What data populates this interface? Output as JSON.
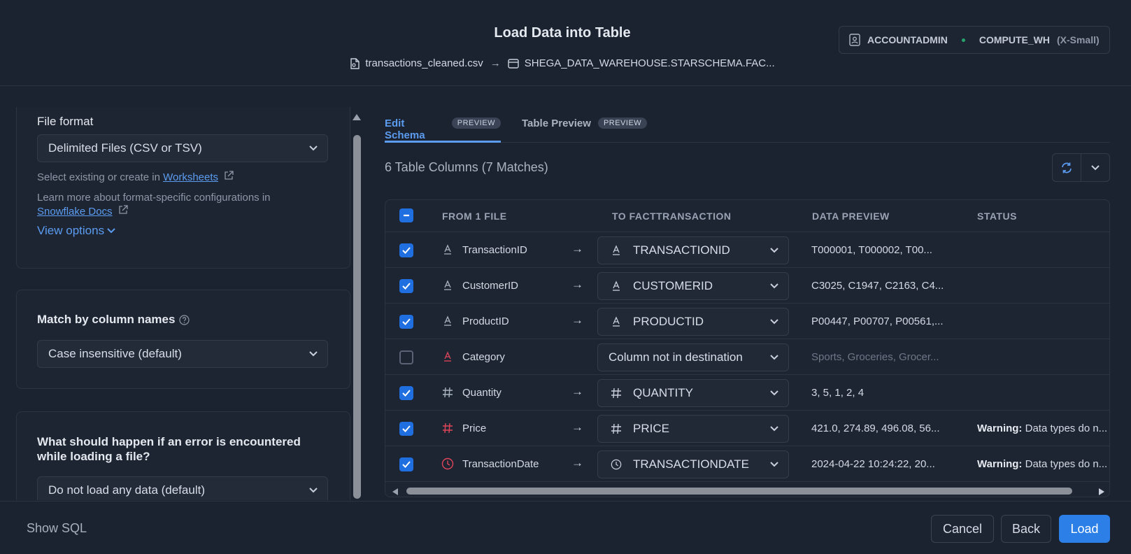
{
  "header": {
    "title": "Load Data into Table",
    "source_file": "transactions_cleaned.csv",
    "arrow": "→",
    "destination": "SHEGA_DATA_WAREHOUSE.STARSCHEMA.FAC...",
    "role": "ACCOUNTADMIN",
    "warehouse": "COMPUTE_WH",
    "warehouse_size": "(X-Small)"
  },
  "left": {
    "file_format": {
      "label": "File format",
      "value": "Delimited Files (CSV or TSV)",
      "help_prefix": "Select existing or create in",
      "help_link": "Worksheets",
      "learn_prefix": "Learn more about format-specific configurations in",
      "learn_link": "Snowflake Docs",
      "view_options": "View options"
    },
    "match": {
      "label": "Match by column names",
      "value": "Case insensitive (default)"
    },
    "on_error": {
      "label_line1": "What should happen if an error is encountered",
      "label_line2": "while loading a file?",
      "value": "Do not load any data (default)"
    }
  },
  "tabs": [
    {
      "label": "Edit Schema",
      "badge": "PREVIEW"
    },
    {
      "label": "Table Preview",
      "badge": "PREVIEW"
    }
  ],
  "summary": "6 Table Columns (7 Matches)",
  "table": {
    "headers": [
      "FROM 1 FILE",
      "TO FACTTRANSACTION",
      "DATA PREVIEW",
      "STATUS"
    ],
    "rows": [
      {
        "checked": true,
        "src_type": "text",
        "src_error": false,
        "src": "TransactionID",
        "arrow": "→",
        "dest_type": "text",
        "dest": "TRANSACTIONID",
        "preview": "T000001, T000002, T00...",
        "status_bold": "",
        "status": ""
      },
      {
        "checked": true,
        "src_type": "text",
        "src_error": false,
        "src": "CustomerID",
        "arrow": "→",
        "dest_type": "text",
        "dest": "CUSTOMERID",
        "preview": "C3025, C1947, C2163, C4...",
        "status_bold": "",
        "status": ""
      },
      {
        "checked": true,
        "src_type": "text",
        "src_error": false,
        "src": "ProductID",
        "arrow": "→",
        "dest_type": "text",
        "dest": "PRODUCTID",
        "preview": "P00447, P00707, P00561,...",
        "status_bold": "",
        "status": ""
      },
      {
        "checked": false,
        "src_type": "text",
        "src_error": true,
        "src": "Category",
        "arrow": "",
        "dest_type": "",
        "dest": "Column not in destination",
        "preview": "Sports, Groceries, Grocer...",
        "status_bold": "",
        "status": ""
      },
      {
        "checked": true,
        "src_type": "number",
        "src_error": false,
        "src": "Quantity",
        "arrow": "→",
        "dest_type": "number",
        "dest": "QUANTITY",
        "preview": "3, 5, 1, 2, 4",
        "status_bold": "",
        "status": ""
      },
      {
        "checked": true,
        "src_type": "number",
        "src_error": true,
        "src": "Price",
        "arrow": "→",
        "dest_type": "number",
        "dest": "PRICE",
        "preview": "421.0, 274.89, 496.08, 56...",
        "status_bold": "Warning:",
        "status": " Data types do n..."
      },
      {
        "checked": true,
        "src_type": "time",
        "src_error": true,
        "src": "TransactionDate",
        "arrow": "→",
        "dest_type": "time",
        "dest": "TRANSACTIONDATE",
        "preview": "2024-04-22 10:24:22, 20...",
        "status_bold": "Warning:",
        "status": " Data types do n..."
      }
    ]
  },
  "footer": {
    "show_sql": "Show SQL",
    "cancel": "Cancel",
    "back": "Back",
    "load": "Load"
  },
  "colors": {
    "accent": "#2b7fe6",
    "link": "#5b9cf0",
    "error": "#e0455a",
    "status_ok": "#25a36b"
  }
}
